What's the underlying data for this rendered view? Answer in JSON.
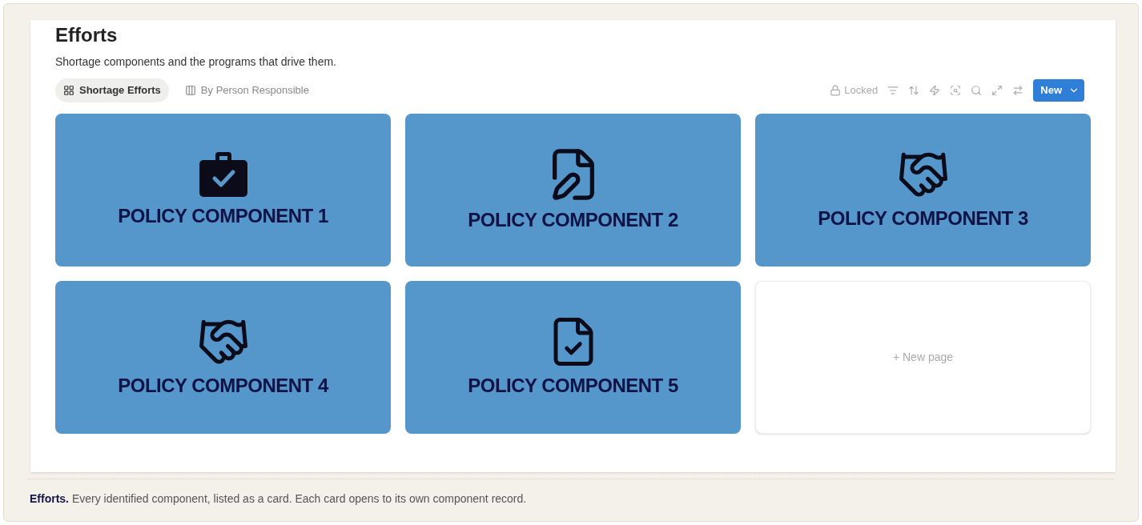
{
  "page": {
    "title": "Efforts",
    "description": "Shortage components and the programs that drive them."
  },
  "tabs": [
    {
      "label": "Shortage Efforts",
      "kind": "gallery",
      "selected": true
    },
    {
      "label": "By Person Responsible",
      "kind": "board",
      "selected": false
    }
  ],
  "toolbar": {
    "lock_label": "Locked",
    "new_button": "New"
  },
  "cards": [
    {
      "kind": "briefcase",
      "title": "POLICY COMPONENT 1"
    },
    {
      "kind": "document-pen",
      "title": "POLICY COMPONENT 2"
    },
    {
      "kind": "handshake",
      "title": "POLICY COMPONENT 3"
    },
    {
      "kind": "handshake",
      "title": "POLICY COMPONENT 4"
    },
    {
      "kind": "document-check",
      "title": "POLICY COMPONENT 5"
    },
    {
      "kind": "new",
      "title": "+ New page"
    }
  ],
  "caption": "**Efforts.** Every identified component, listed as a card. Each card opens to its own component record."
}
